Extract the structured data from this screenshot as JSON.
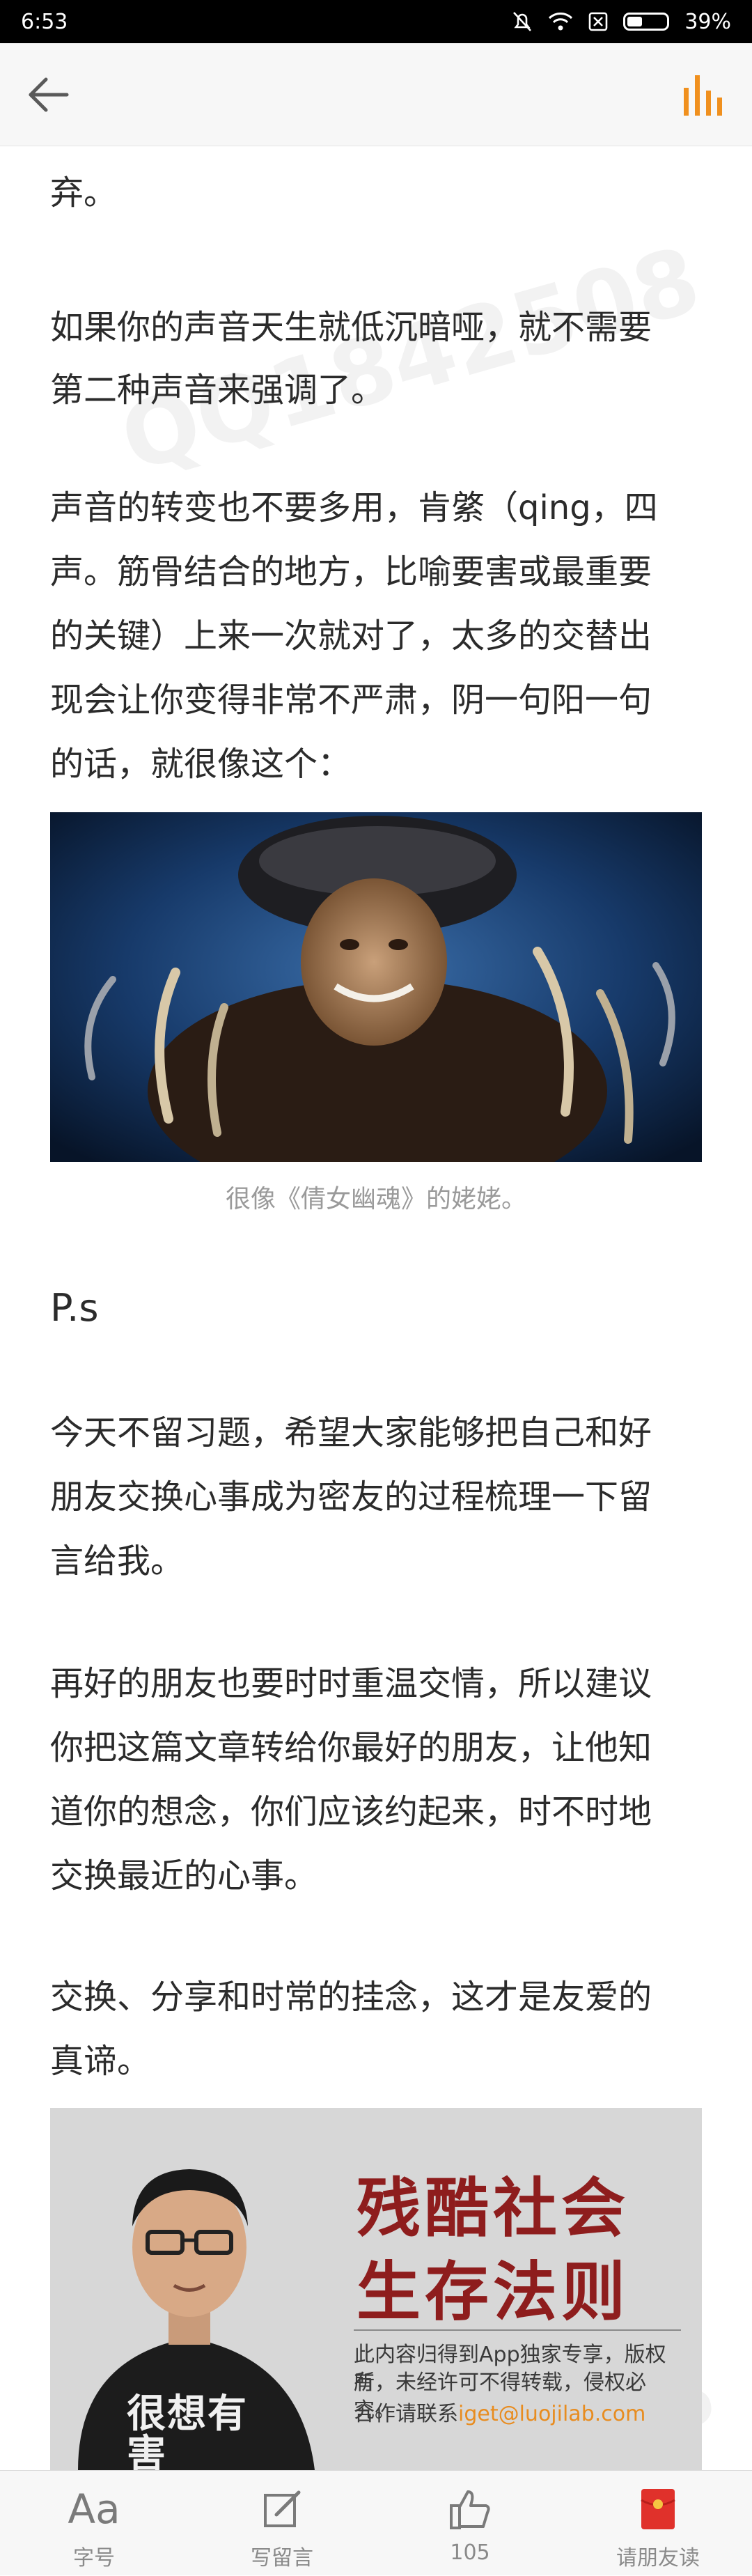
{
  "status_bar": {
    "time": "6:53",
    "battery": "39%",
    "battery_level": 0.39
  },
  "header": {
    "back_icon": "arrow-left-icon",
    "audio_icon": "audio-bars-icon",
    "accent_color": "#f0901e"
  },
  "article": {
    "p0": "弃。",
    "p1_l1": "如果你的声音天生就低沉暗哑，就不需要",
    "p1_l2": "第二种声音来强调了。",
    "p2_l1": "声音的转变也不要多用，肯綮（qing，四",
    "p2_l2": "声。筋骨结合的地方，比喻要害或最重要",
    "p2_l3": "的关键）上来一次就对了，太多的交替出",
    "p2_l4": "现会让你变得非常不严肃，阴一句阳一句",
    "p2_l5": "的话，就很像这个：",
    "image_caption": "很像《倩女幽魂》的姥姥。",
    "heading": "P.s",
    "p3_l1": "今天不留习题，希望大家能够把自己和好",
    "p3_l2": "朋友交换心事成为密友的过程梳理一下留",
    "p3_l3": "言给我。",
    "p4_l1": "再好的朋友也要时时重温交情，所以建议",
    "p4_l2": "你把这篇文章转给你最好的朋友，让他知",
    "p4_l3": "道你的想念，你们应该约起来，时不时地",
    "p4_l4": "交换最近的心事。",
    "p5_l1": "交换、分享和时常的挂念，这才是友爱的",
    "p5_l2": "真谛。"
  },
  "banner": {
    "title_l1": "残酷社会",
    "title_l2": "生存法则",
    "notice_l1": "此内容归得到App独家专享，版权所",
    "notice_l2": "有，未经许可不得转载，侵权必究。",
    "contact_label": "合作请联系",
    "contact_email": "iget@luojilab.com",
    "shirt_text": "很想有害",
    "title_color": "#8e1d1d"
  },
  "bottom_bar": {
    "font_label": "字号",
    "font_icon_text": "Aa",
    "comment_label": "写留言",
    "like_count": "105",
    "share_label": "请朋友读"
  }
}
